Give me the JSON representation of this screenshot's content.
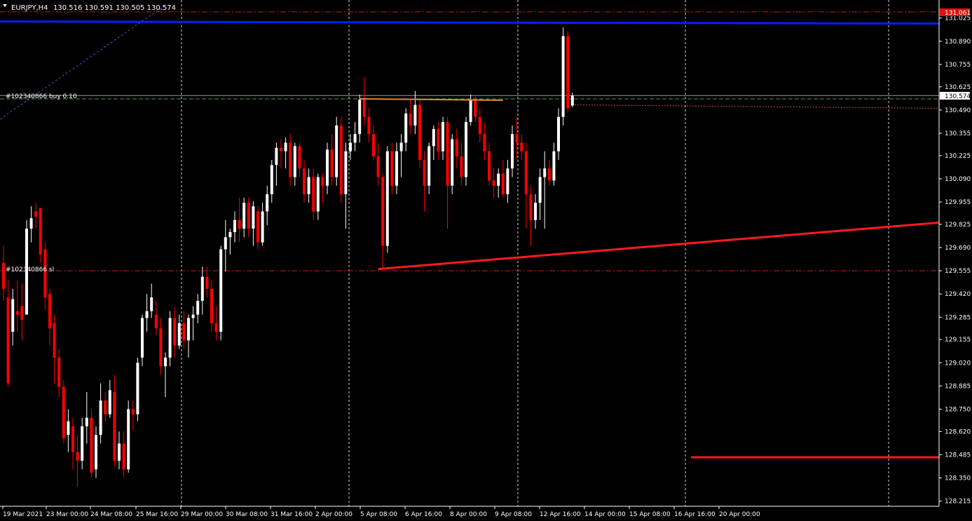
{
  "header": {
    "menu_icon": "triangle-down-icon",
    "symbol": "EURJPY,H4",
    "ohlc": "130.516 130.591 130.505 130.574"
  },
  "labels": {
    "order_buy": "#102340866 buy 0.10",
    "order_sl": "#102340866 sl"
  },
  "price_tags": {
    "top": "131.061",
    "current": "130.574"
  },
  "colors": {
    "background": "#000000",
    "bull": "#ffffff",
    "bear": "#ff0000",
    "grid": "#ffffff",
    "blue_line": "#0020ff",
    "trend": "#ff1a1a",
    "level_dashdot": "#c81e1e",
    "buy_level": "#4a9a4a",
    "orange_line": "#e08a2a"
  },
  "chart_data": {
    "type": "candlestick",
    "title": "EURJPY,H4",
    "ylim": [
      128.185,
      131.13
    ],
    "y_ticks": [
      131.025,
      130.89,
      130.755,
      130.625,
      130.49,
      130.355,
      130.225,
      130.09,
      129.955,
      129.825,
      129.69,
      129.555,
      129.42,
      129.285,
      129.155,
      129.02,
      128.885,
      128.75,
      128.62,
      128.485,
      128.35,
      128.215
    ],
    "x_ticks": [
      "19 Mar 2021",
      "23 Mar 00:00",
      "24 Mar 08:00",
      "25 Mar 16:00",
      "29 Mar 00:00",
      "30 Mar 08:00",
      "31 Mar 16:00",
      "2 Apr 00:00",
      "5 Apr 08:00",
      "6 Apr 16:00",
      "8 Apr 00:00",
      "9 Apr 08:00",
      "12 Apr 16:00",
      "14 Apr 00:00",
      "15 Apr 08:00",
      "16 Apr 16:00",
      "20 Apr 00:00"
    ],
    "grid": "vertical dashed at every second date",
    "levels": {
      "top_dashdot": 131.061,
      "blue_line": 131.005,
      "buy_entry": 130.555,
      "stop_loss": 129.555,
      "current_price": 130.574,
      "horizontal_red": 128.47
    },
    "trendline": {
      "from_bar": 81,
      "from_price": 129.565,
      "to_bar": "right edge",
      "to_price": 129.835
    },
    "candles": [
      [
        129.6,
        129.7,
        129.38,
        129.45
      ],
      [
        129.4,
        129.5,
        128.88,
        128.9
      ],
      [
        129.2,
        129.45,
        129.12,
        129.39
      ],
      [
        129.32,
        129.5,
        129.2,
        129.3
      ],
      [
        129.35,
        129.48,
        129.15,
        129.27
      ],
      [
        129.3,
        129.85,
        129.3,
        129.8
      ],
      [
        129.8,
        129.93,
        129.72,
        129.86
      ],
      [
        129.9,
        129.95,
        129.8,
        129.87
      ],
      [
        129.92,
        129.92,
        129.6,
        129.65
      ],
      [
        129.68,
        129.72,
        129.33,
        129.4
      ],
      [
        129.42,
        129.45,
        129.12,
        129.22
      ],
      [
        129.25,
        129.3,
        128.9,
        129.05
      ],
      [
        129.05,
        129.1,
        128.82,
        128.88
      ],
      [
        128.88,
        128.92,
        128.55,
        128.58
      ],
      [
        128.6,
        128.75,
        128.5,
        128.68
      ],
      [
        128.65,
        128.7,
        128.4,
        128.5
      ],
      [
        128.5,
        128.6,
        128.3,
        128.45
      ],
      [
        128.45,
        128.7,
        128.4,
        128.65
      ],
      [
        128.65,
        128.85,
        128.55,
        128.7
      ],
      [
        128.7,
        128.75,
        128.35,
        128.38
      ],
      [
        128.4,
        128.65,
        128.35,
        128.6
      ],
      [
        128.6,
        128.9,
        128.55,
        128.8
      ],
      [
        128.8,
        128.85,
        128.68,
        128.72
      ],
      [
        128.72,
        128.92,
        128.7,
        128.86
      ],
      [
        128.85,
        128.95,
        128.42,
        128.45
      ],
      [
        128.45,
        128.62,
        128.4,
        128.55
      ],
      [
        128.55,
        128.62,
        128.35,
        128.4
      ],
      [
        128.4,
        128.8,
        128.38,
        128.75
      ],
      [
        128.75,
        128.8,
        128.63,
        128.72
      ],
      [
        128.72,
        129.05,
        128.68,
        129.02
      ],
      [
        129.05,
        129.3,
        129.0,
        129.28
      ],
      [
        129.28,
        129.42,
        129.2,
        129.32
      ],
      [
        129.32,
        129.48,
        129.28,
        129.4
      ],
      [
        129.3,
        129.38,
        129.18,
        129.22
      ],
      [
        129.22,
        129.28,
        128.95,
        129.0
      ],
      [
        129.0,
        129.08,
        128.82,
        129.05
      ],
      [
        129.05,
        129.32,
        129.0,
        129.28
      ],
      [
        129.28,
        129.34,
        129.05,
        129.12
      ],
      [
        129.12,
        129.3,
        129.1,
        129.25
      ],
      [
        129.25,
        129.32,
        129.1,
        129.15
      ],
      [
        129.15,
        129.3,
        129.05,
        129.28
      ],
      [
        129.28,
        129.35,
        129.15,
        129.3
      ],
      [
        129.3,
        129.42,
        129.25,
        129.38
      ],
      [
        129.38,
        129.58,
        129.3,
        129.52
      ],
      [
        129.52,
        129.58,
        129.4,
        129.45
      ],
      [
        129.45,
        129.5,
        129.2,
        129.25
      ],
      [
        129.25,
        129.35,
        129.15,
        129.2
      ],
      [
        129.2,
        129.7,
        129.15,
        129.68
      ],
      [
        129.68,
        129.85,
        129.55,
        129.75
      ],
      [
        129.75,
        129.8,
        129.65,
        129.78
      ],
      [
        129.78,
        129.9,
        129.72,
        129.85
      ],
      [
        129.85,
        129.98,
        129.72,
        129.8
      ],
      [
        129.8,
        129.98,
        129.75,
        129.95
      ],
      [
        129.95,
        129.98,
        129.75,
        129.8
      ],
      [
        129.8,
        129.96,
        129.7,
        129.93
      ],
      [
        129.9,
        129.93,
        129.68,
        129.72
      ],
      [
        129.72,
        129.95,
        129.7,
        129.9
      ],
      [
        129.9,
        130.05,
        129.82,
        130.0
      ],
      [
        130.0,
        130.2,
        129.95,
        130.17
      ],
      [
        130.17,
        130.3,
        130.05,
        130.27
      ],
      [
        130.27,
        130.32,
        130.15,
        130.25
      ],
      [
        130.25,
        130.33,
        130.15,
        130.3
      ],
      [
        130.3,
        130.35,
        130.05,
        130.1
      ],
      [
        130.1,
        130.3,
        130.05,
        130.28
      ],
      [
        130.28,
        130.3,
        130.1,
        130.15
      ],
      [
        130.15,
        130.2,
        129.95,
        130.0
      ],
      [
        130.0,
        130.15,
        129.95,
        130.1
      ],
      [
        130.1,
        130.15,
        129.85,
        129.9
      ],
      [
        129.9,
        130.12,
        129.85,
        130.1
      ],
      [
        130.1,
        130.12,
        129.95,
        130.05
      ],
      [
        130.05,
        130.3,
        130.0,
        130.26
      ],
      [
        130.26,
        130.35,
        130.05,
        130.1
      ],
      [
        130.1,
        130.45,
        130.05,
        130.4
      ],
      [
        130.4,
        130.45,
        129.95,
        130.0
      ],
      [
        130.0,
        130.3,
        129.8,
        130.25
      ],
      [
        130.25,
        130.35,
        130.2,
        130.3
      ],
      [
        130.3,
        130.42,
        130.25,
        130.35
      ],
      [
        130.35,
        130.58,
        130.3,
        130.55
      ],
      [
        130.55,
        130.68,
        130.4,
        130.45
      ],
      [
        130.45,
        130.5,
        130.3,
        130.35
      ],
      [
        130.35,
        130.4,
        130.2,
        130.22
      ],
      [
        130.22,
        130.3,
        130.05,
        130.1
      ],
      [
        130.1,
        130.12,
        129.565,
        129.7
      ],
      [
        129.7,
        130.28,
        129.66,
        130.25
      ],
      [
        130.25,
        130.3,
        130.0,
        130.05
      ],
      [
        130.05,
        130.3,
        130.0,
        130.25
      ],
      [
        130.25,
        130.35,
        130.1,
        130.3
      ],
      [
        130.3,
        130.5,
        130.25,
        130.47
      ],
      [
        130.47,
        130.55,
        130.35,
        130.4
      ],
      [
        130.4,
        130.6,
        130.35,
        130.52
      ],
      [
        130.52,
        130.55,
        130.15,
        130.2
      ],
      [
        130.2,
        130.25,
        129.9,
        130.05
      ],
      [
        130.05,
        130.3,
        130.0,
        130.28
      ],
      [
        130.28,
        130.4,
        130.2,
        130.38
      ],
      [
        130.38,
        130.42,
        130.2,
        130.25
      ],
      [
        130.25,
        130.45,
        130.2,
        130.42
      ],
      [
        130.42,
        130.45,
        129.8,
        130.05
      ],
      [
        130.05,
        130.35,
        130.0,
        130.32
      ],
      [
        130.32,
        130.38,
        130.15,
        130.22
      ],
      [
        130.22,
        130.3,
        130.05,
        130.1
      ],
      [
        130.1,
        130.45,
        130.05,
        130.42
      ],
      [
        130.42,
        130.58,
        130.4,
        130.55
      ],
      [
        130.55,
        130.58,
        130.42,
        130.45
      ],
      [
        130.45,
        130.5,
        130.3,
        130.35
      ],
      [
        130.35,
        130.42,
        130.2,
        130.25
      ],
      [
        130.25,
        130.3,
        130.05,
        130.08
      ],
      [
        130.08,
        130.15,
        129.98,
        130.05
      ],
      [
        130.05,
        130.15,
        129.98,
        130.12
      ],
      [
        130.12,
        130.2,
        129.98,
        130.0
      ],
      [
        130.0,
        130.2,
        129.95,
        130.15
      ],
      [
        130.15,
        130.4,
        130.1,
        130.35
      ],
      [
        130.35,
        130.45,
        130.2,
        130.3
      ],
      [
        130.3,
        130.35,
        130.2,
        130.25
      ],
      [
        130.25,
        130.3,
        129.8,
        130.0
      ],
      [
        130.0,
        130.05,
        129.7,
        129.85
      ],
      [
        129.85,
        130.0,
        129.8,
        129.95
      ],
      [
        129.95,
        130.15,
        129.85,
        130.1
      ],
      [
        130.1,
        130.25,
        129.8,
        130.15
      ],
      [
        130.15,
        130.2,
        130.05,
        130.08
      ],
      [
        130.08,
        130.3,
        130.05,
        130.25
      ],
      [
        130.25,
        130.5,
        130.2,
        130.45
      ],
      [
        130.45,
        130.97,
        130.4,
        130.92
      ],
      [
        130.92,
        130.95,
        130.48,
        130.5
      ],
      [
        130.516,
        130.591,
        130.505,
        130.574
      ]
    ]
  }
}
